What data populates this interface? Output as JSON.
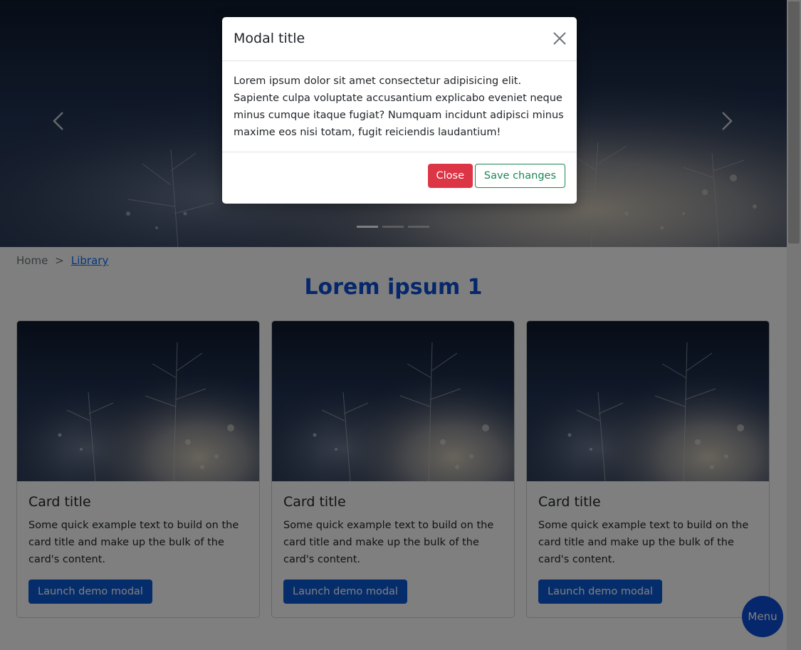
{
  "carousel": {
    "prev_icon": "chevron-left-icon",
    "next_icon": "chevron-right-icon",
    "indicators": [
      {
        "active": true
      },
      {
        "active": false
      },
      {
        "active": false
      }
    ]
  },
  "breadcrumb": {
    "home": "Home",
    "separator": ">",
    "current": "Library"
  },
  "page_title": "Lorem ipsum 1",
  "cards": [
    {
      "title": "Card title",
      "text": "Some quick example text to build on the card title and make up the bulk of the card's content.",
      "button": "Launch demo modal"
    },
    {
      "title": "Card title",
      "text": "Some quick example text to build on the card title and make up the bulk of the card's content.",
      "button": "Launch demo modal"
    },
    {
      "title": "Card title",
      "text": "Some quick example text to build on the card title and make up the bulk of the card's content.",
      "button": "Launch demo modal"
    }
  ],
  "menu_button": "Menu",
  "modal": {
    "title": "Modal title",
    "close_icon": "close-icon",
    "body": "Lorem ipsum dolor sit amet consectetur adipisicing elit. Sapiente culpa voluptate accusantium explicabo eveniet neque minus cumque itaque fugiat? Numquam incidunt adipisci minus maxime eos nisi totam, fugit reiciendis laudantium!",
    "close_button": "Close",
    "save_button": "Save changes"
  },
  "colors": {
    "primary": "#0d5ad6",
    "title_blue": "#0d4fd6",
    "danger": "#dc3545",
    "success": "#198754"
  }
}
